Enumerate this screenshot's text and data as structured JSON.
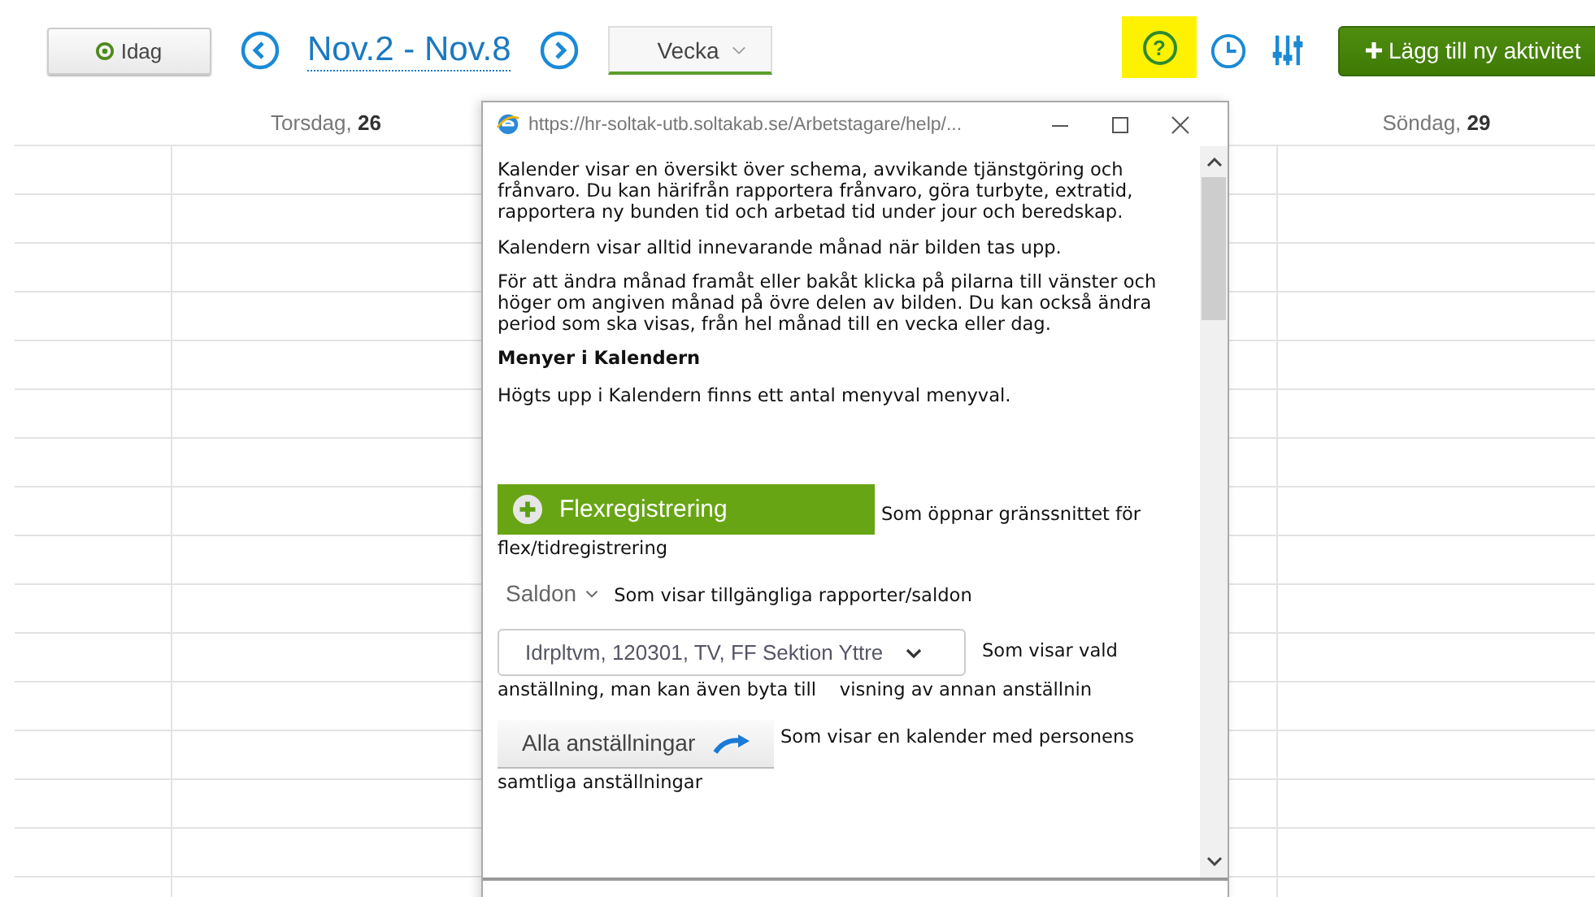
{
  "toolbar": {
    "today_button": "Idag",
    "date_range": "Nov.2 - Nov.8",
    "view_select": "Vecka",
    "help_icon": "?",
    "help_highlighted": true,
    "add_button": "Lägg till ny aktivitet"
  },
  "day_headers": [
    {
      "day": "Torsdag,",
      "date": "26"
    },
    {
      "day": "Söndag,",
      "date": "29"
    }
  ],
  "popup": {
    "url": "https://hr-soltak-utb.soltakab.se/Arbetstagare/help/...",
    "items": [
      {
        "kind": "text",
        "text": "Kalender visar en översikt över schema, avvikande tjänstgöring och frånvaro. Du kan härifrån rapportera frånvaro, göra turbyte, extratid, rapportera ny bunden tid och arbetad tid under jour och beredskap."
      },
      {
        "kind": "text",
        "text": "Kalendern visar alltid innevarande månad när bilden tas upp."
      },
      {
        "kind": "text",
        "text": "För att ändra månad framåt eller bakåt klicka på pilarna till vänster och höger om angiven månad på övre delen av bilden. Du kan också ändra period som ska visas, från hel månad till en vecka eller dag."
      },
      {
        "kind": "heading",
        "text": "Menyer i Kalendern"
      },
      {
        "kind": "text",
        "text": "Högts upp i Kalendern finns ett antal menyval menyval."
      },
      {
        "kind": "green_button",
        "label": "Flexregistrering",
        "text": "Som öppnar gränssnittet för",
        "text2": "flex/tidregistrering"
      },
      {
        "kind": "menu",
        "label": "Saldon",
        "text": "Som visar tillgängliga rapporter/saldon"
      },
      {
        "kind": "select",
        "label": "Idrpltvm, 120301, TV, FF Sektion Yttre",
        "text": "Som visar vald",
        "text2": "anställning, man kan även byta till    visning av annan anställnin"
      },
      {
        "kind": "gray_button",
        "label": "Alla anställningar",
        "text": "Som visar en kalender med personens",
        "text2": "samtliga anställningar"
      }
    ]
  }
}
